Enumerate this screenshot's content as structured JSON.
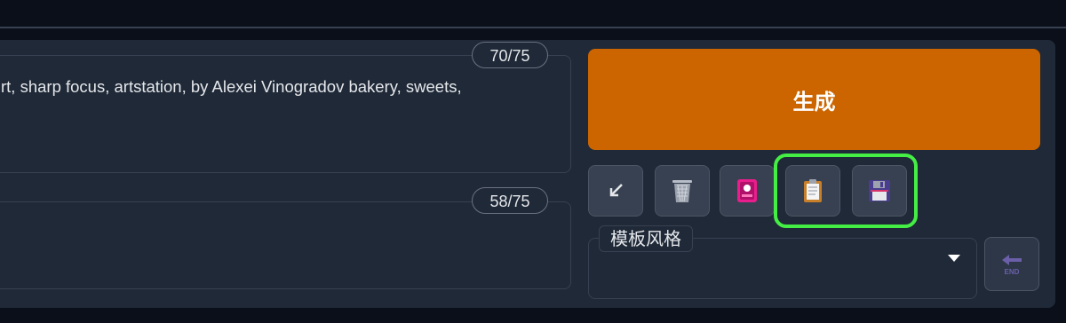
{
  "prompt": {
    "positive_text": "rt, sharp focus, artstation, by Alexei Vinogradov bakery, sweets,",
    "positive_token_count": "70/75",
    "negative_text": "",
    "negative_token_count": "58/75"
  },
  "actions": {
    "generate_label": "生成",
    "tools": [
      {
        "name": "read-params-icon",
        "glyph": "↙"
      },
      {
        "name": "trash-icon",
        "glyph": "🗑"
      },
      {
        "name": "picture-icon",
        "glyph": "🎴"
      },
      {
        "name": "clipboard-icon",
        "glyph": "📋"
      },
      {
        "name": "floppy-disk-icon",
        "glyph": "💾"
      }
    ]
  },
  "styles": {
    "label": "模板风格",
    "selected": "",
    "apply_icon": "end-arrow-icon",
    "apply_text": "END"
  },
  "colors": {
    "generate": "#cc6500",
    "highlight": "#44ee44",
    "background": "#0b0f19",
    "panel": "#1f2937"
  }
}
